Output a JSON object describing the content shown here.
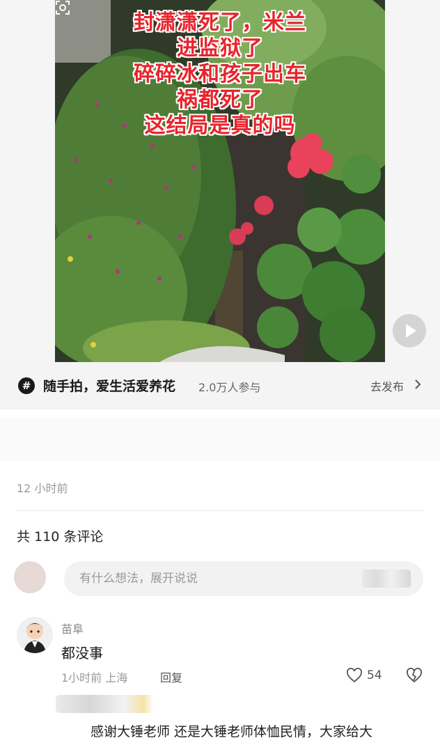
{
  "post": {
    "image_overlay_lines": [
      "封潇潇死了，米兰",
      "进监狱了",
      "碎碎冰和孩子出车",
      "祸都死了",
      "这结局是真的吗"
    ],
    "time": "12 小时前"
  },
  "topic": {
    "icon_symbol": "#",
    "name": "随手拍，爱生活爱养花",
    "participants": "2.0万人参与",
    "action": "去发布"
  },
  "comments": {
    "count_label": "共 110 条评论",
    "input_placeholder": "有什么想法，展开说说",
    "items": [
      {
        "username": "苗阜",
        "text": "都没事",
        "time_location": "1小时前  上海",
        "reply_label": "回复",
        "likes": "54"
      }
    ],
    "reply_preview": "感谢大锤老师 还是大锤老师体恤民情，大家给大"
  },
  "colors": {
    "overlay_text": "#e8242c",
    "topic_bar_bg": "#f4f4f4",
    "input_bg": "#f2f2f2",
    "muted_text": "#999999"
  },
  "icons": [
    "hashtag-icon",
    "chevron-right-icon",
    "play-icon",
    "image-scan-icon",
    "heart-icon",
    "broken-heart-icon"
  ]
}
